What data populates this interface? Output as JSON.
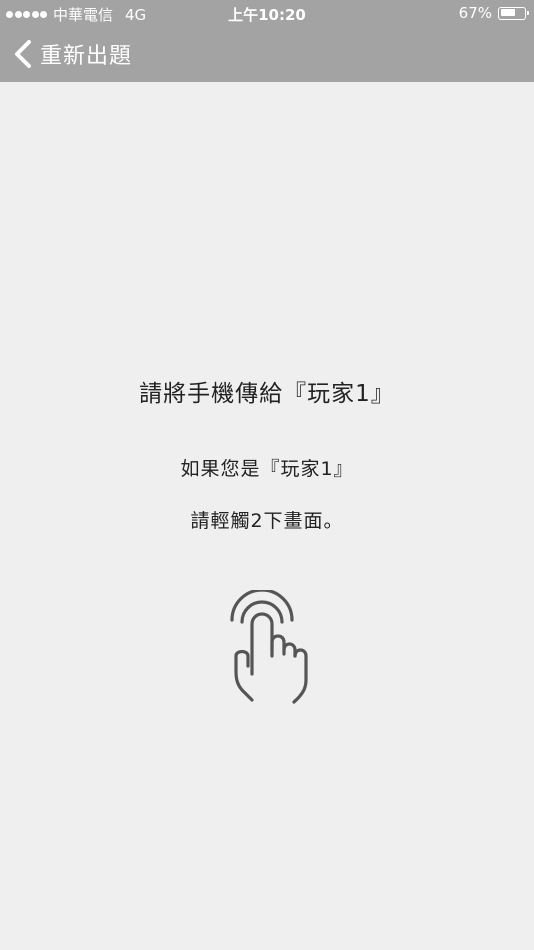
{
  "status_bar": {
    "carrier": "中華電信",
    "network": "4G",
    "time": "上午10:20",
    "battery_percent": "67%",
    "battery_level": 0.67,
    "signal_bars": 5
  },
  "nav": {
    "back_label": "重新出題",
    "back_icon": "chevron-left-icon"
  },
  "main": {
    "instruction": "請將手機傳給『玩家1』",
    "confirm_line1": "如果您是『玩家1』",
    "confirm_line2": "請輕觸2下畫面。",
    "gesture_icon": "double-tap-hand-icon"
  },
  "colors": {
    "header_bg": "#a3a3a3",
    "page_bg": "#efefef",
    "text": "#222222",
    "icon": "#555555"
  }
}
